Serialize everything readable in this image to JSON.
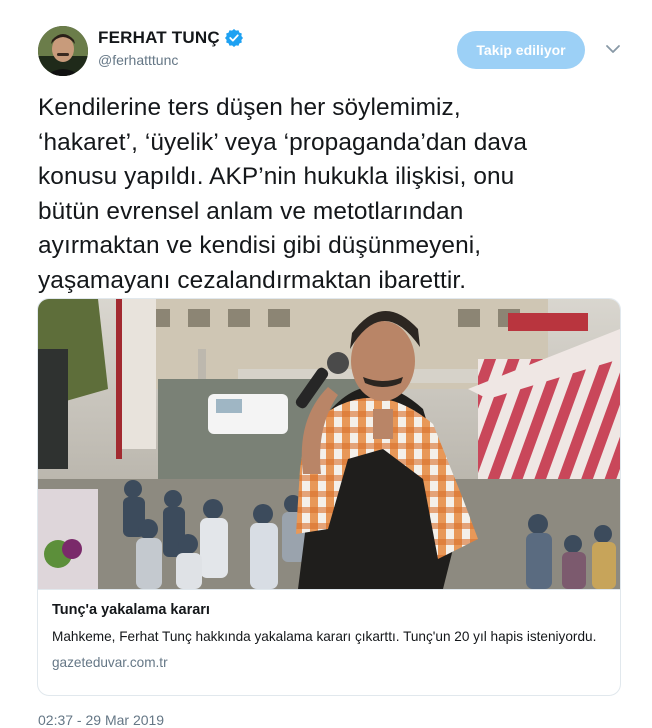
{
  "user": {
    "display_name": "FERHAT TUNÇ",
    "handle": "@ferhatttunc",
    "verified": true
  },
  "follow_button": {
    "label": "Takip ediliyor"
  },
  "icons": {
    "verified": "verified-badge-icon",
    "more": "chevron-down-icon"
  },
  "tweet": {
    "text": "Kendilerine ters düşen her söylemimiz,\n‘hakaret’, ‘üyelik’ veya ‘propaganda’dan dava\nkonusu yapıldı. AKP’nin hukukla ilişkisi, onu\nbütün evrensel anlam ve metotlarından\nayırmaktan ve kendisi gibi düşünmeyeni,\nyaşamayanı cezalandırmaktan ibarettir."
  },
  "link_card": {
    "title": "Tunç'a yakalama kararı",
    "description": "Mahkeme, Ferhat Tunç hakkında yakalama kararı çıkarttı. Tunç'un 20 yıl hapis isteniyordu.",
    "domain": "gazeteduvar.com.tr"
  },
  "timestamp": "02:37 - 29 Mar 2019",
  "colors": {
    "accent": "#1da1f2",
    "follow_button_bg": "#9cd0f6",
    "secondary_text": "#657786",
    "border": "#e1e8ed"
  }
}
